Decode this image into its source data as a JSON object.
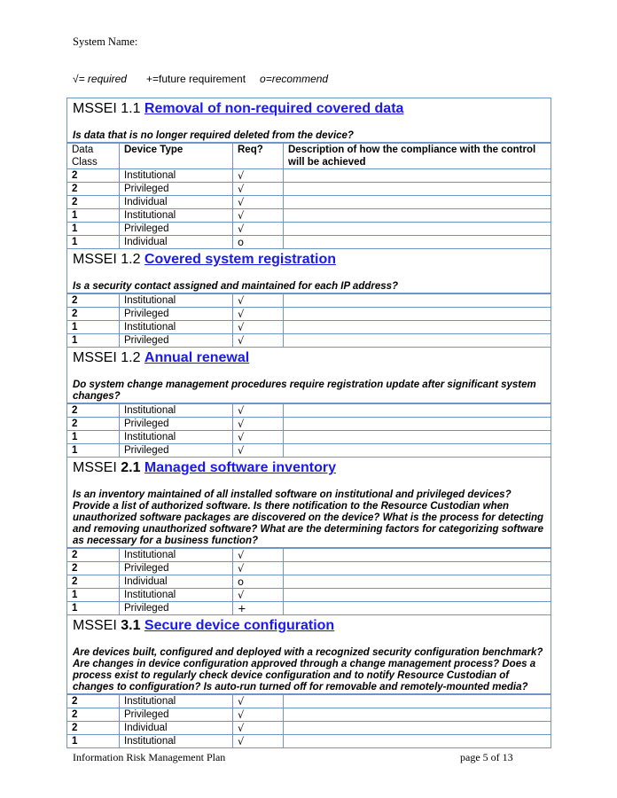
{
  "header": {
    "system_name_label": "System Name:"
  },
  "legend": {
    "required_symbol": "√",
    "required_text": "= required",
    "future_text": "+=future requirement",
    "recommend_text": "o=recommend"
  },
  "table": {
    "column_headers": {
      "data_class": "Data Class",
      "device_type": "Device Type",
      "req": "Req?",
      "description": "Description of how the compliance with the control will be achieved"
    },
    "border_color": "#6f95c8",
    "link_color": "#1a1aee",
    "sections": [
      {
        "prefix": "MSSEI 1.1 ",
        "number_bold": "",
        "link_title": "Removal of non-required covered data",
        "question": "Is data that is no longer required deleted from the device?",
        "has_header": true,
        "rows": [
          {
            "data_class": "2",
            "device_type": "Institutional",
            "req": "√",
            "description": ""
          },
          {
            "data_class": "2",
            "device_type": "Privileged",
            "req": "√",
            "description": ""
          },
          {
            "data_class": "2",
            "device_type": "Individual",
            "req": "√",
            "description": ""
          },
          {
            "data_class": "1",
            "device_type": "Institutional",
            "req": "√",
            "description": ""
          },
          {
            "data_class": "1",
            "device_type": "Privileged",
            "req": "√",
            "description": ""
          },
          {
            "data_class": "1",
            "device_type": "Individual",
            "req": "o",
            "description": ""
          }
        ]
      },
      {
        "prefix": "MSSEI 1.2 ",
        "number_bold": "",
        "link_title": "Covered system registration",
        "question": "Is a security contact assigned and maintained for each IP address?",
        "has_header": false,
        "rows": [
          {
            "data_class": "2",
            "device_type": "Institutional",
            "req": "√",
            "description": ""
          },
          {
            "data_class": "2",
            "device_type": "Privileged",
            "req": "√",
            "description": ""
          },
          {
            "data_class": "1",
            "device_type": "Institutional",
            "req": "√",
            "description": ""
          },
          {
            "data_class": "1",
            "device_type": "Privileged",
            "req": "√",
            "description": ""
          }
        ]
      },
      {
        "prefix": "MSSEI 1.2 ",
        "number_bold": "",
        "link_title": "Annual renewal",
        "question": "Do system change management procedures require registration update after significant system changes?",
        "has_header": false,
        "rows": [
          {
            "data_class": "2",
            "device_type": "Institutional",
            "req": "√",
            "description": ""
          },
          {
            "data_class": "2",
            "device_type": "Privileged",
            "req": "√",
            "description": ""
          },
          {
            "data_class": "1",
            "device_type": "Institutional",
            "req": "√",
            "description": ""
          },
          {
            "data_class": "1",
            "device_type": "Privileged",
            "req": "√",
            "description": ""
          }
        ]
      },
      {
        "prefix": "MSSEI ",
        "number_bold": "2.1 ",
        "link_title": "Managed software inventory",
        "question": "Is an inventory maintained of all installed software on institutional and privileged devices? Provide a list of authorized software. Is there notification to the Resource Custodian when unauthorized software packages are discovered on the device?  What is the process for detecting and removing unauthorized software? What are the determining factors for categorizing software as necessary for a business function?",
        "has_header": false,
        "rows": [
          {
            "data_class": "2",
            "device_type": "Institutional",
            "req": "√",
            "description": ""
          },
          {
            "data_class": "2",
            "device_type": "Privileged",
            "req": "√",
            "description": ""
          },
          {
            "data_class": "2",
            "device_type": "Individual",
            "req": "o",
            "description": ""
          },
          {
            "data_class": "1",
            "device_type": "Institutional",
            "req": "√",
            "description": ""
          },
          {
            "data_class": "1",
            "device_type": "Privileged",
            "req": "+",
            "description": ""
          }
        ]
      },
      {
        "prefix": "MSSEI ",
        "number_bold": "3.1 ",
        "link_title": "Secure device configuration",
        "question": "Are devices built, configured and deployed with a recognized security configuration benchmark? Are changes in device configuration approved through a change management process? Does a process exist to regularly check device configuration and to notify Resource Custodian of changes to configuration? Is auto-run turned off for removable and remotely-mounted media?",
        "has_header": false,
        "rows": [
          {
            "data_class": "2",
            "device_type": "Institutional",
            "req": "√",
            "description": ""
          },
          {
            "data_class": "2",
            "device_type": "Privileged",
            "req": "√",
            "description": ""
          },
          {
            "data_class": "2",
            "device_type": "Individual",
            "req": "√",
            "description": ""
          },
          {
            "data_class": "1",
            "device_type": "Institutional",
            "req": "√",
            "description": ""
          }
        ]
      }
    ]
  },
  "footer": {
    "document_title": "Information Risk Management Plan",
    "page_indicator": "page 5 of 13"
  }
}
